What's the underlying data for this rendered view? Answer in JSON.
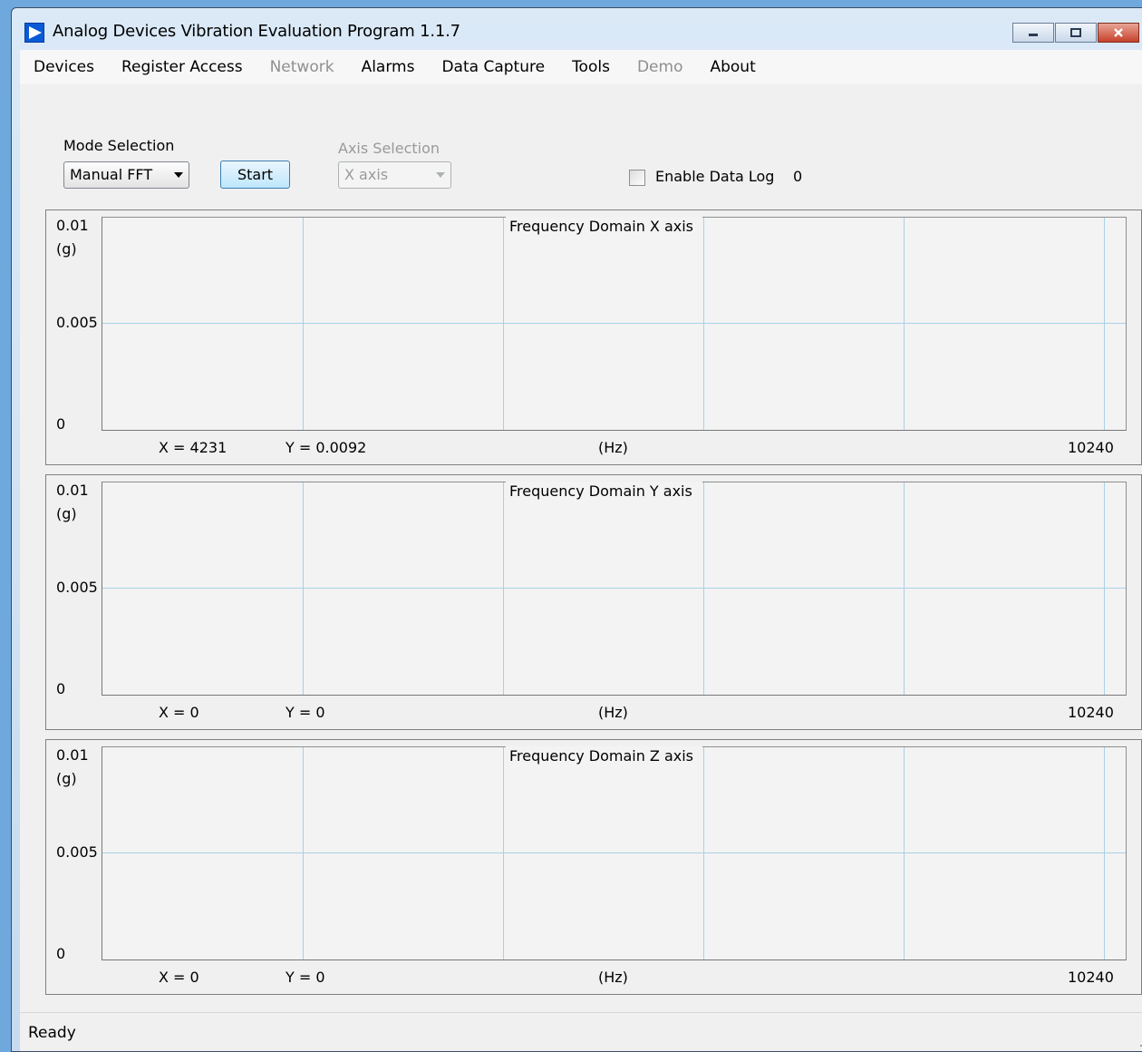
{
  "window": {
    "title": "Analog Devices Vibration Evaluation Program  1.1.7"
  },
  "menu": [
    {
      "label": "Devices",
      "enabled": true
    },
    {
      "label": "Register Access",
      "enabled": true
    },
    {
      "label": "Network",
      "enabled": false
    },
    {
      "label": "Alarms",
      "enabled": true
    },
    {
      "label": "Data Capture",
      "enabled": true
    },
    {
      "label": "Tools",
      "enabled": true
    },
    {
      "label": "Demo",
      "enabled": false
    },
    {
      "label": "About",
      "enabled": true
    }
  ],
  "controls": {
    "mode_label": "Mode Selection",
    "mode_value": "Manual FFT",
    "start_label": "Start",
    "axis_label": "Axis Selection",
    "axis_value": "X axis",
    "data_log_label": "Enable Data Log",
    "data_log_checked": false,
    "data_log_count": "0"
  },
  "plots": [
    {
      "title": "Frequency Domain X axis",
      "y_max": "0.01",
      "y_unit": "(g)",
      "y_mid": "0.005",
      "y_min": "0",
      "cursor_x": "X = 4231",
      "cursor_y": "Y = 0.0092",
      "x_unit": "(Hz)",
      "x_max": "10240"
    },
    {
      "title": "Frequency Domain Y axis",
      "y_max": "0.01",
      "y_unit": "(g)",
      "y_mid": "0.005",
      "y_min": "0",
      "cursor_x": "X = 0",
      "cursor_y": "Y = 0",
      "x_unit": "(Hz)",
      "x_max": "10240"
    },
    {
      "title": "Frequency Domain Z axis",
      "y_max": "0.01",
      "y_unit": "(g)",
      "y_mid": "0.005",
      "y_min": "0",
      "cursor_x": "X = 0",
      "cursor_y": "Y = 0",
      "x_unit": "(Hz)",
      "x_max": "10240"
    }
  ],
  "status": {
    "text": "Ready"
  },
  "colors": {
    "gridline": "#a9d1e6",
    "disabled_text": "#8f8f8f",
    "logo_blue": "#0a5ad6"
  }
}
